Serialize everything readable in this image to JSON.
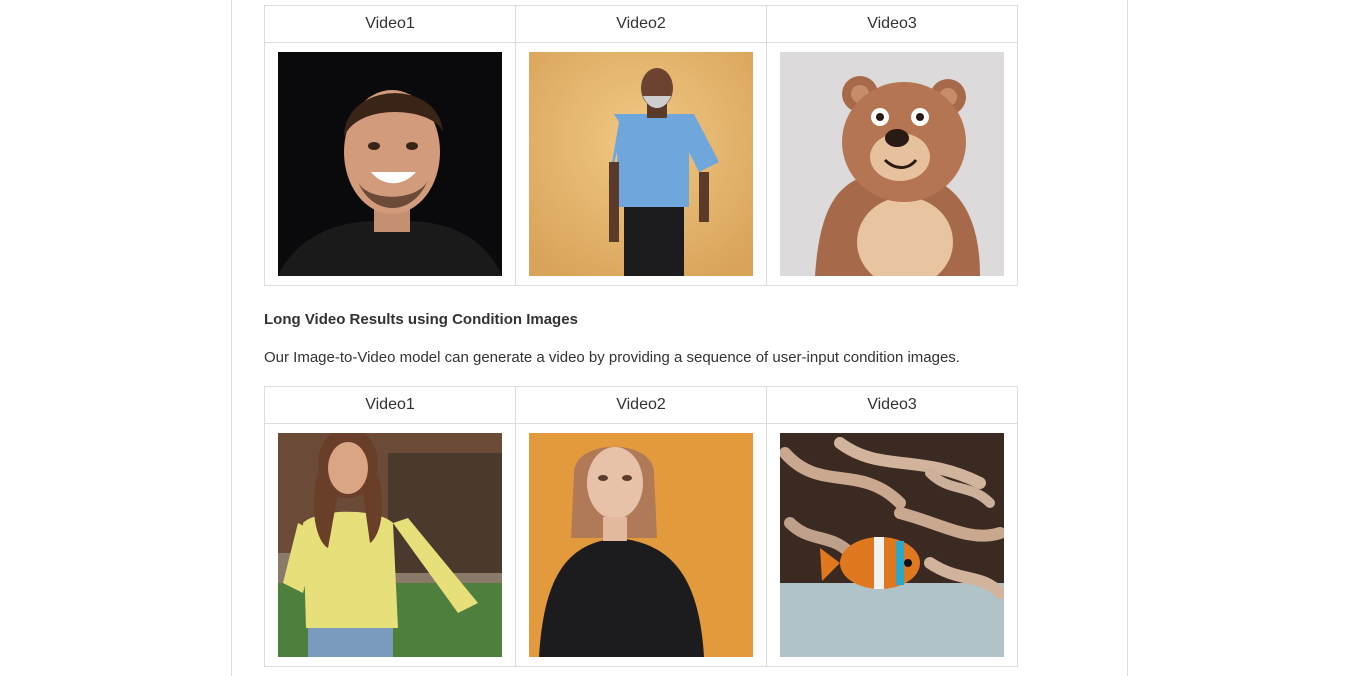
{
  "grid_1": {
    "headers": [
      "Video1",
      "Video2",
      "Video3"
    ],
    "thumbnails": [
      {
        "icon": "smiling-man-portrait"
      },
      {
        "icon": "elderly-man-blue-shirt"
      },
      {
        "icon": "cartoon-bear"
      }
    ]
  },
  "section": {
    "title": "Long Video Results using Condition Images",
    "description": "Our Image-to-Video model can generate a video by providing a sequence of user-input condition images."
  },
  "grid_2": {
    "headers": [
      "Video1",
      "Video2",
      "Video3"
    ],
    "thumbnails": [
      {
        "icon": "woman-yellow-top"
      },
      {
        "icon": "woman-black-shirt-orange-bg"
      },
      {
        "icon": "clownfish-anemone"
      }
    ]
  }
}
